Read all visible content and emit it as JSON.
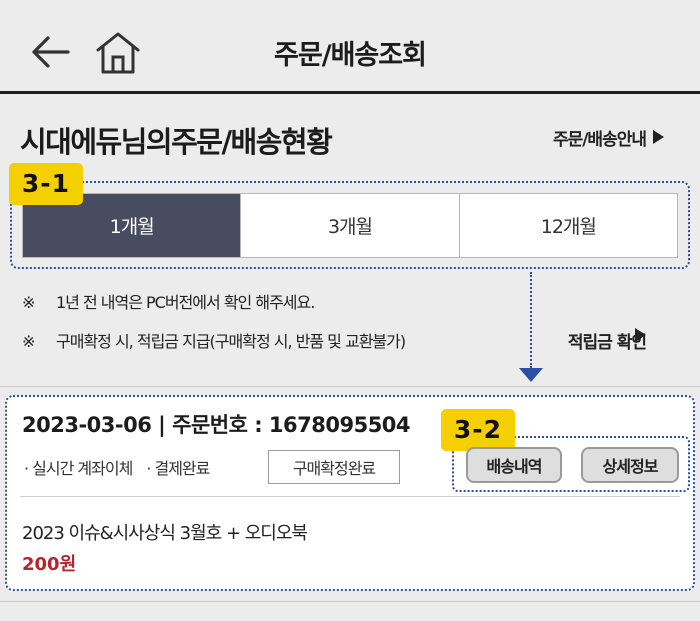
{
  "header": {
    "title": "주문/배송조회",
    "back_icon": "back-arrow-icon",
    "home_icon": "home-icon"
  },
  "page": {
    "title": "시대에듀님의주문/배송현황",
    "guide_link": "주문/배송안내"
  },
  "callouts": {
    "badge_1": "3-1",
    "badge_2": "3-2",
    "accent_color": "#2d4ea8",
    "badge_color": "#f5d000"
  },
  "period_tabs": {
    "items": [
      "1개월",
      "3개월",
      "12개월"
    ],
    "selected": "1개월"
  },
  "notices": {
    "mark": "※",
    "line_1": "1년 전 내역은 PC버전에서 확인 해주세요.",
    "line_2": "구매확정 시, 적립금 지급(구매확정 시, 반품 및 교환불가)",
    "points_link": "적립금 확인"
  },
  "order": {
    "header": "2023-03-06 | 주문번호 : 1678095504",
    "payment_method": "· 실시간 계좌이체",
    "payment_status": "· 결제완료",
    "confirm_status": "구매확정완료",
    "delivery_button": "배송내역",
    "detail_button": "상세정보",
    "product_name": "2023 이슈&시사상식 3월호 + 오디오북",
    "price": "200원"
  }
}
